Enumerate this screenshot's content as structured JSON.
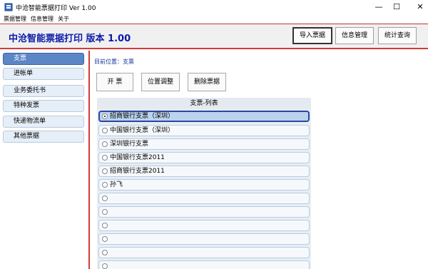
{
  "window": {
    "title": "中沧智能票据打印 Ver 1.00"
  },
  "menu": {
    "items": [
      "票据管理",
      "信息管理",
      "关于"
    ]
  },
  "header": {
    "title": "中沧智能票据打印    版本 1.00",
    "buttons": {
      "import": "导入票据",
      "info": "信息管理",
      "stats": "统计查询"
    }
  },
  "sidebar": {
    "items": [
      {
        "label": "支票",
        "active": true
      },
      {
        "label": "进帐单"
      },
      {
        "label": "业务委托书"
      },
      {
        "label": "特种发票"
      },
      {
        "label": "快递物流单"
      },
      {
        "label": "其他票据"
      }
    ]
  },
  "main": {
    "breadcrumb": "目前位置：支票",
    "actions": {
      "open": "开  票",
      "position": "位置调整",
      "delete": "删除票据"
    },
    "list_title": "支票-列表",
    "rows": [
      {
        "label": "招商银行支票（深圳）",
        "selected": true
      },
      {
        "label": "中国银行支票（深圳）"
      },
      {
        "label": "深圳银行支票"
      },
      {
        "label": "中国银行支票2011"
      },
      {
        "label": "招商银行支票2011"
      },
      {
        "label": "孙飞"
      },
      {
        "label": ""
      },
      {
        "label": ""
      },
      {
        "label": ""
      },
      {
        "label": ""
      },
      {
        "label": ""
      },
      {
        "label": ""
      }
    ]
  },
  "colors": {
    "accent_red": "#d33a3a",
    "title_blue": "#0a1aa8",
    "active_blue": "#5d86c7"
  }
}
